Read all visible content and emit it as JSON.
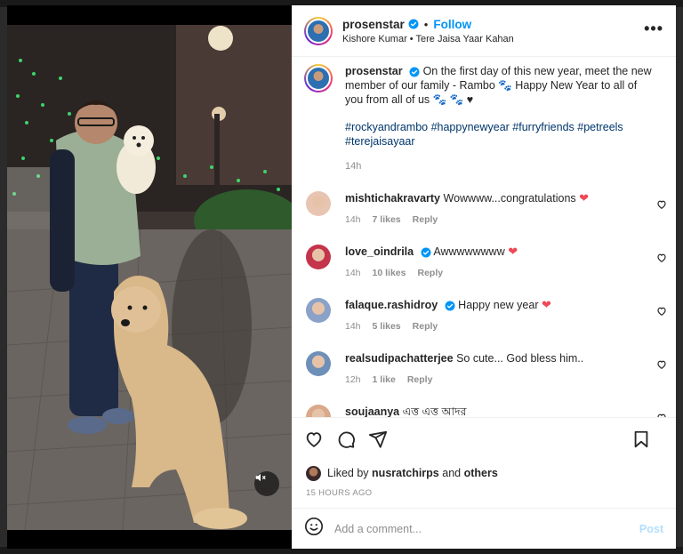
{
  "post": {
    "username": "prosenstar",
    "follow_label": "Follow",
    "separator": "•",
    "audio": "Kishore Kumar • Tere Jaisa Yaar Kahan",
    "more_label": "•••"
  },
  "caption": {
    "username": "prosenstar",
    "text": "On the first day of this new year, meet the new member of our family - Rambo 🐾 Happy New Year to all of you from all of us 🐾 🐾 ♥",
    "hashtags": "#rockyandrambo #happynewyear #furryfriends #petreels #terejaisayaar",
    "age": "14h"
  },
  "comments": [
    {
      "username": "mishtichakravarty",
      "text": "Wowwww...congratulations",
      "heart": "❤",
      "age": "14h",
      "likes": "7 likes",
      "reply": "Reply",
      "verified": false,
      "avatar_color": "#e8c4b2"
    },
    {
      "username": "love_oindrila",
      "text": "Awwwwwwww",
      "heart": "❤",
      "age": "14h",
      "likes": "10 likes",
      "reply": "Reply",
      "verified": true,
      "avatar_color": "#c4344a"
    },
    {
      "username": "falaque.rashidroy",
      "text": "Happy new year",
      "heart": "❤",
      "age": "14h",
      "likes": "5 likes",
      "reply": "Reply",
      "verified": true,
      "avatar_color": "#8aa2c8"
    },
    {
      "username": "realsudipachatterjee",
      "text": "So cute... God bless him..",
      "heart": "",
      "age": "12h",
      "likes": "1 like",
      "reply": "Reply",
      "verified": false,
      "avatar_color": "#6e8fb8"
    },
    {
      "username": "soujaanya",
      "text": "এত্ত এত্ত আদর",
      "heart": "",
      "age": "",
      "likes": "",
      "reply": "",
      "verified": false,
      "avatar_color": "#d9a98a"
    }
  ],
  "likes": {
    "prefix": "Liked by",
    "user": "nusratchirps",
    "and": "and",
    "others": "others"
  },
  "timestamp": "15 HOURS AGO",
  "add_comment": {
    "placeholder": "Add a comment...",
    "post_label": "Post"
  },
  "colors": {
    "link_blue": "#0095f6",
    "hashtag_blue": "#00376b",
    "heart_red": "#ed4956",
    "muted_text": "#8e8e8e",
    "post_disabled": "#b2dffc"
  },
  "icons": [
    "heart-icon",
    "comment-icon",
    "share-icon",
    "bookmark-icon",
    "emoji-icon",
    "mute-icon",
    "verified-icon",
    "more-icon"
  ]
}
